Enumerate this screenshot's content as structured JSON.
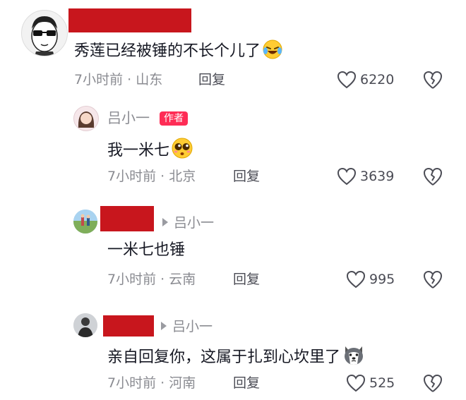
{
  "comments": [
    {
      "text": "秀莲已经被锤的不长个儿了",
      "emoji_icon": "laughing-crying-face",
      "meta": "7小时前 · 山东",
      "reply_label": "回复",
      "likes": "6220"
    },
    {
      "username": "吕小一",
      "badge": "作者",
      "text": "我一米七",
      "emoji_icon": "pleading-face",
      "meta": "7小时前 · 北京",
      "reply_label": "回复",
      "likes": "3639"
    },
    {
      "reply_to": "吕小一",
      "text": "一米七也锤",
      "meta": "7小时前 · 云南",
      "reply_label": "回复",
      "likes": "995"
    },
    {
      "reply_to": "吕小一",
      "text": "亲自回复你，这属于扎到心坎里了",
      "emoji_icon": "husky-dog-face",
      "meta": "7小时前 · 河南",
      "reply_label": "回复",
      "likes": "525"
    }
  ],
  "colors": {
    "redaction": "#c8161d",
    "author_badge": "#fe2c55",
    "meta_text": "#8a8b91"
  }
}
